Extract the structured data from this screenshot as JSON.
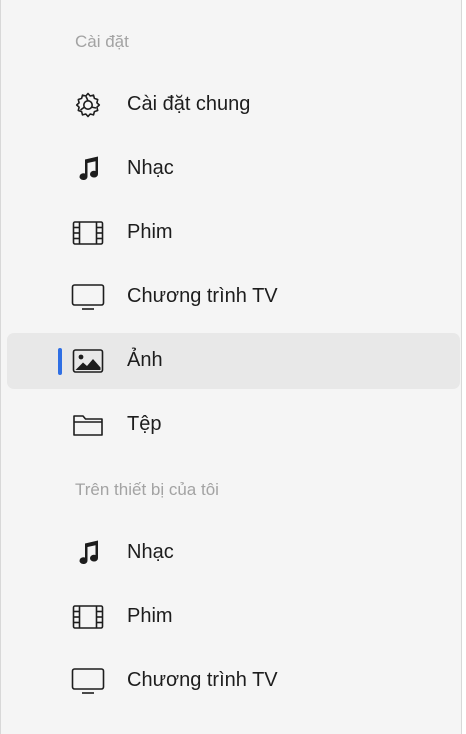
{
  "sections": [
    {
      "header": "Cài đặt",
      "items": [
        {
          "label": "Cài đặt chung",
          "icon": "gear-icon"
        },
        {
          "label": "Nhạc",
          "icon": "music-note-icon"
        },
        {
          "label": "Phim",
          "icon": "film-icon"
        },
        {
          "label": "Chương trình TV",
          "icon": "tv-icon"
        },
        {
          "label": "Ảnh",
          "icon": "photo-icon",
          "selected": true
        },
        {
          "label": "Tệp",
          "icon": "folder-icon"
        }
      ]
    },
    {
      "header": "Trên thiết bị của tôi",
      "items": [
        {
          "label": "Nhạc",
          "icon": "music-note-icon"
        },
        {
          "label": "Phim",
          "icon": "film-icon"
        },
        {
          "label": "Chương trình TV",
          "icon": "tv-icon"
        }
      ]
    }
  ],
  "colors": {
    "selection_indicator": "#2f6fe4",
    "selected_background": "#e8e8e8",
    "sidebar_background": "#f5f5f5"
  }
}
